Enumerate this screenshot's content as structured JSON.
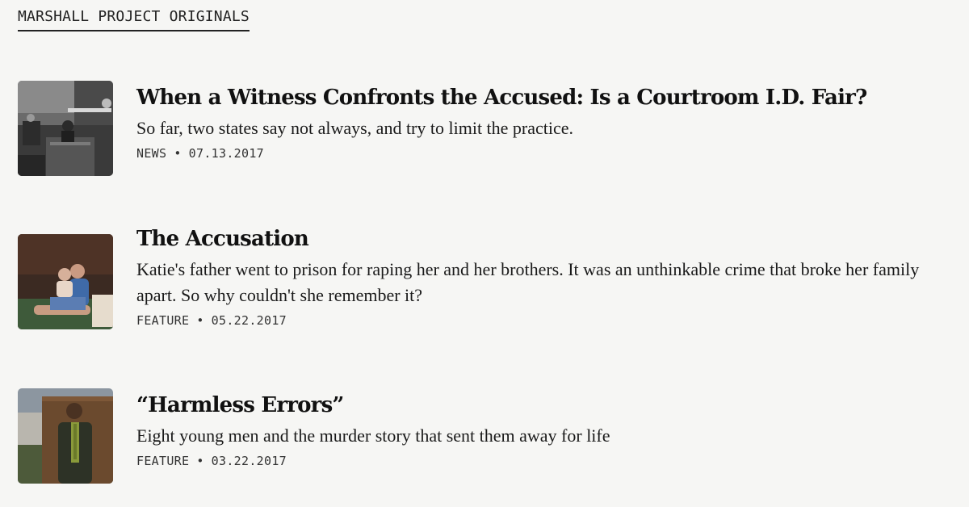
{
  "section": {
    "label": "MARSHALL PROJECT ORIGINALS"
  },
  "articles": [
    {
      "headline": "When a Witness Confronts the Accused: Is a Courtroom I.D. Fair?",
      "dek": "So far, two states say not always, and try to limit the practice.",
      "category": "NEWS",
      "separator": "•",
      "date": "07.13.2017"
    },
    {
      "headline": "The Accusation",
      "dek": "Katie's father went to prison for raping her and her brothers. It was an unthinkable crime that broke her family apart. So why couldn't she remember it?",
      "category": "FEATURE",
      "separator": "•",
      "date": "05.22.2017"
    },
    {
      "headline": "“Harmless Errors”",
      "dek": "Eight young men and the murder story that sent them away for life",
      "category": "FEATURE",
      "separator": "•",
      "date": "03.22.2017"
    }
  ]
}
